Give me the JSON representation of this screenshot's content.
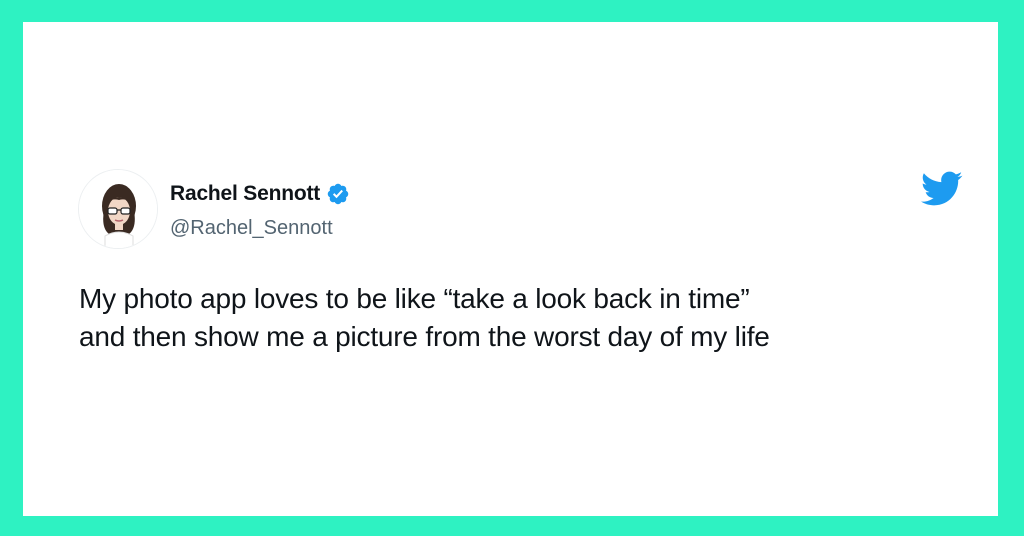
{
  "tweet": {
    "author": {
      "display_name": "Rachel Sennott",
      "handle": "@Rachel_Sennott",
      "verified": true,
      "avatar_icon": "profile-photo"
    },
    "lines": [
      "My photo app loves to be like “take a look back in time”",
      "and then show me a picture from the worst day of my life"
    ],
    "platform_icon": "twitter-bird-icon"
  },
  "colors": {
    "frame": "#2ef2c2",
    "card": "#ffffff",
    "text": "#0f1419",
    "handle": "#536471",
    "brand_blue": "#1d9bf0"
  }
}
